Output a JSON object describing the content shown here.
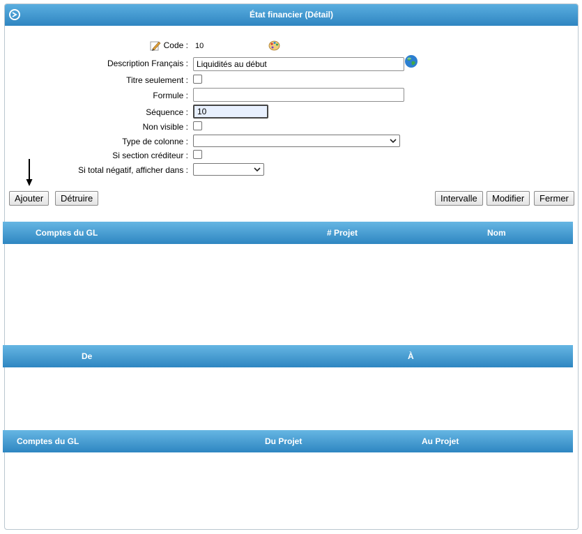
{
  "window": {
    "title": "État financier (Détail)"
  },
  "form": {
    "code_label": "Code :",
    "code_value": "10",
    "description_label": "Description Français :",
    "description_value": "Liquidités au début",
    "titre_label": "Titre seulement :",
    "formule_label": "Formule :",
    "formule_value": "",
    "sequence_label": "Séquence :",
    "sequence_value": "10",
    "non_visible_label": "Non visible :",
    "type_colonne_label": "Type de colonne :",
    "type_colonne_value": "",
    "si_section_label": "Si section créditeur :",
    "si_total_label": "Si total négatif, afficher dans :",
    "si_total_value": ""
  },
  "buttons": {
    "ajouter": "Ajouter",
    "detruire": "Détruire",
    "intervalle": "Intervalle",
    "modifier": "Modifier",
    "fermer": "Fermer"
  },
  "grid1": {
    "columns": [
      "Comptes du GL",
      "# Projet",
      "Nom"
    ]
  },
  "grid2": {
    "columns": [
      "De",
      "À"
    ]
  },
  "grid3": {
    "columns": [
      "Comptes du GL",
      "Du Projet",
      "Au Projet"
    ]
  },
  "colors": {
    "header_top": "#66b6e3",
    "header_bottom": "#2e86c1"
  },
  "icons": [
    "toggle-arrow-icon",
    "edit-pencil-icon",
    "palette-icon",
    "globe-icon",
    "dropdown-arrow-icon",
    "down-arrow-indicator"
  ]
}
